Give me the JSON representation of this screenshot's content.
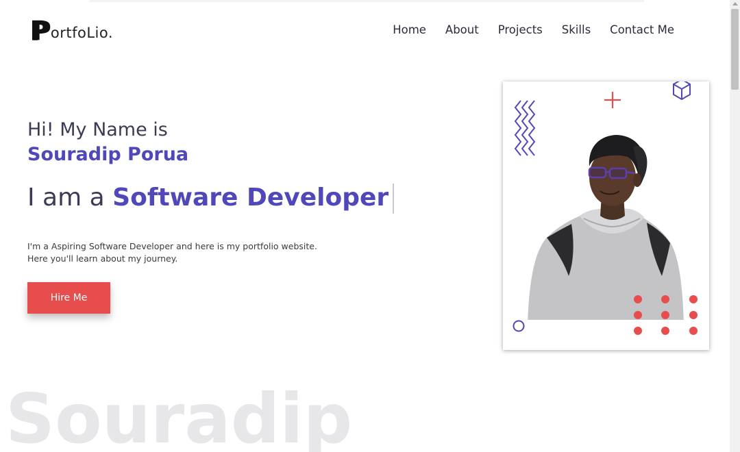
{
  "logo": {
    "letter": "P",
    "rest": "ortfoLio."
  },
  "nav": [
    "Home",
    "About",
    "Projects",
    "Skills",
    "Contact Me"
  ],
  "hero": {
    "greeting": "Hi! My Name is",
    "name": "Souradip Porua",
    "role_prefix": "I am a",
    "role": "Software Developer",
    "description_line1": "I'm a Aspiring Software Developer and here is my portfolio website.",
    "description_line2": "Here you'll learn about my journey.",
    "cta_label": "Hire Me"
  },
  "watermark": "Souradip",
  "colors": {
    "accent": "#5048b8",
    "cta": "#e84d4d",
    "text": "#3b3b55"
  }
}
